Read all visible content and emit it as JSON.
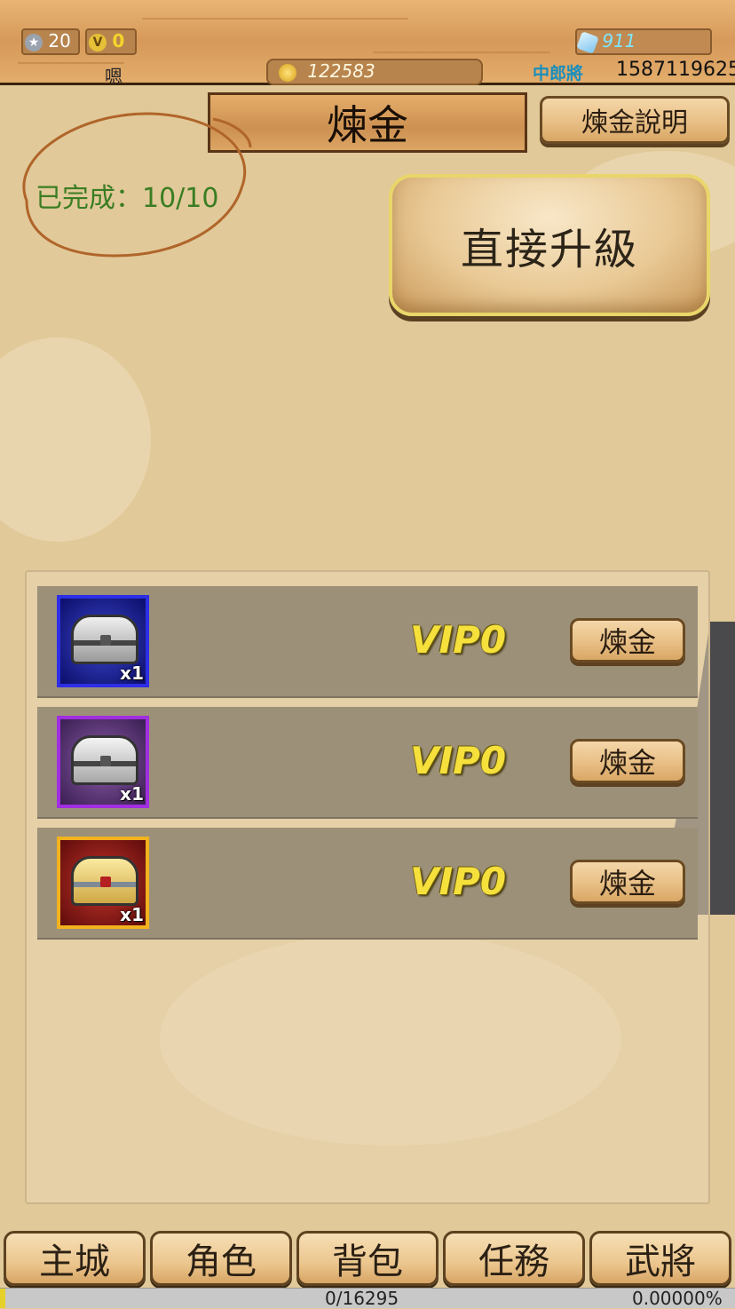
{
  "topbar": {
    "star_count": "20",
    "vip_badge": "V",
    "vip_count": "0",
    "player_name": "嗯",
    "gold": "122583",
    "diamonds": "911",
    "rank": "中郎將",
    "player_id": "1587119625"
  },
  "header": {
    "title": "煉金",
    "help_button": "煉金說明"
  },
  "status": {
    "completed_label": "已完成：10/10"
  },
  "actions": {
    "upgrade_button": "直接升級"
  },
  "items": [
    {
      "frame_color": "#2d2ee6",
      "chest": "silver-chest-icon",
      "qty": "x1",
      "vip": "VIP0",
      "button": "煉金"
    },
    {
      "frame_color": "#a12ee0",
      "chest": "silver-chest-icon",
      "qty": "x1",
      "vip": "VIP0",
      "button": "煉金"
    },
    {
      "frame_color": "#f2b21e",
      "chest": "gold-chest-icon",
      "qty": "x1",
      "vip": "VIP0",
      "button": "煉金"
    }
  ],
  "nav": {
    "items": [
      "主城",
      "角色",
      "背包",
      "任務",
      "武將"
    ]
  },
  "footer": {
    "xp": "0/16295",
    "xp_fraction": 0,
    "percent": "0.00000%"
  },
  "colors": {
    "status_green": "#3a7d22",
    "vip_yellow": "#f5e03c",
    "annotation_circle": "#b0652a"
  }
}
